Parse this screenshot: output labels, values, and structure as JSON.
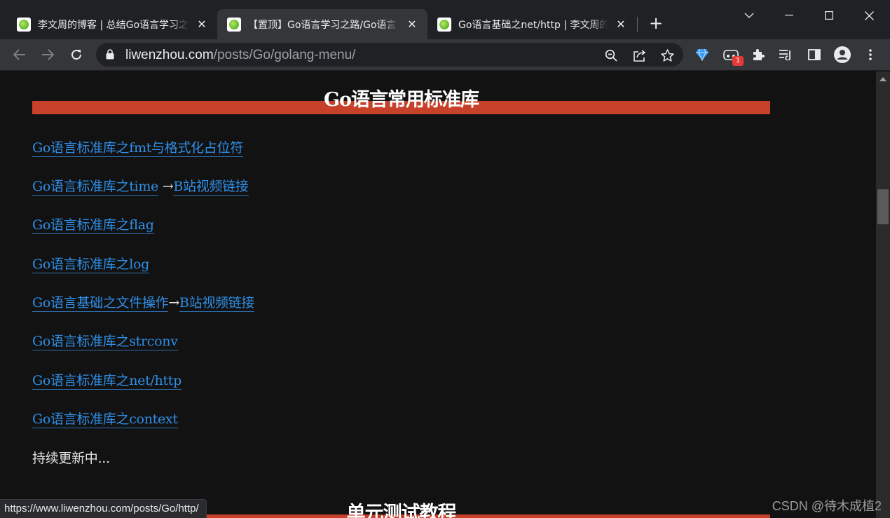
{
  "tabs": [
    {
      "title": "李文周的博客 | 总结Go语言学习之",
      "active": false
    },
    {
      "title": "【置顶】Go语言学习之路/Go语言",
      "active": true
    },
    {
      "title": "Go语言基础之net/http | 李文周的",
      "active": false
    }
  ],
  "tab_close_glyph": "✕",
  "new_tab_glyph": "+",
  "address": {
    "host": "liwenzhou.com",
    "path": "/posts/Go/golang-menu/"
  },
  "extension_badge": "1",
  "content": {
    "section1_title": "Go语言常用标准库",
    "items": [
      {
        "link": "Go语言标准库之fmt与格式化占位符"
      },
      {
        "link": "Go语言标准库之time",
        "arrow": " →",
        "link2": "B站视频链接"
      },
      {
        "link": "Go语言标准库之flag"
      },
      {
        "link": "Go语言标准库之log"
      },
      {
        "link": "Go语言基础之文件操作",
        "arrow": "→",
        "link2": "B站视频链接"
      },
      {
        "link": "Go语言标准库之strconv"
      },
      {
        "link": "Go语言标准库之net/http"
      },
      {
        "link": "Go语言标准库之context"
      }
    ],
    "updating_text": "持续更新中...",
    "section2_title": "单元测试教程"
  },
  "status_url": "https://www.liwenzhou.com/posts/Go/http/",
  "watermark": "CSDN @待木成植2",
  "colors": {
    "link": "#2f8fe8",
    "section_bar": "#c7402a",
    "page_bg": "#121212",
    "tabstrip_bg": "#202124",
    "toolbar_bg": "#35363a"
  }
}
